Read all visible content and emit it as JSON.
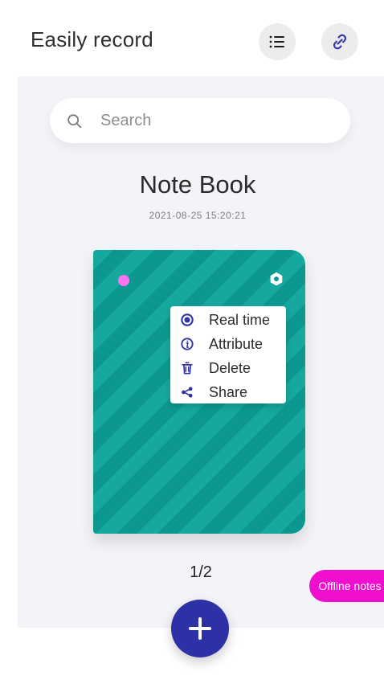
{
  "app": {
    "title": "Easily record"
  },
  "header": {
    "menu_icon": "list-icon",
    "link_icon": "link-icon"
  },
  "search": {
    "placeholder": "Search",
    "icon": "search-icon"
  },
  "notebook": {
    "title": "Note Book",
    "timestamp": "2021-08-25 15:20:21",
    "cover_color": "#16a79f",
    "indicator_color": "#ff73ef",
    "settings_icon": "hexagon-settings-icon",
    "menu": [
      {
        "label": "Real time",
        "icon": "radio-icon"
      },
      {
        "label": "Attribute",
        "icon": "info-icon"
      },
      {
        "label": "Delete",
        "icon": "trash-icon"
      },
      {
        "label": "Share",
        "icon": "share-icon"
      }
    ]
  },
  "pager": {
    "text": "1/2"
  },
  "offline_notes": {
    "label": "Offline notes",
    "color": "#f00ecf"
  },
  "fab": {
    "label": "+",
    "color": "#2e31a5"
  }
}
